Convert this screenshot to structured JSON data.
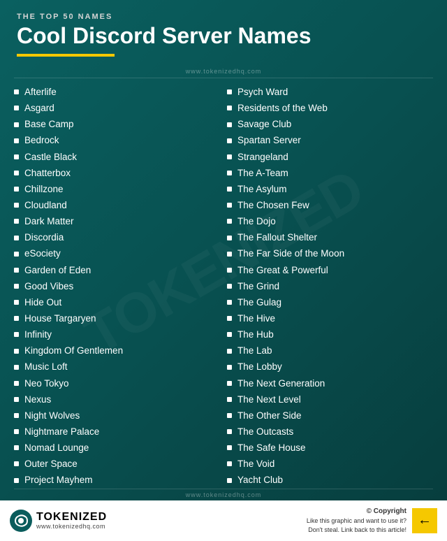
{
  "header": {
    "top_label": "THE TOP 50 NAMES",
    "main_title": "Cool Discord Server Names",
    "website": "www.tokenizedhq.com"
  },
  "column_left": {
    "items": [
      "Afterlife",
      "Asgard",
      "Base Camp",
      "Bedrock",
      "Castle Black",
      "Chatterbox",
      "Chillzone",
      "Cloudland",
      "Dark Matter",
      "Discordia",
      "eSociety",
      "Garden of Eden",
      "Good Vibes",
      "Hide Out",
      "House Targaryen",
      "Infinity",
      "Kingdom Of Gentlemen",
      "Music Loft",
      "Neo Tokyo",
      "Nexus",
      "Night Wolves",
      "Nightmare Palace",
      "Nomad Lounge",
      "Outer Space",
      "Project Mayhem"
    ]
  },
  "column_right": {
    "items": [
      "Psych Ward",
      "Residents of the Web",
      "Savage Club",
      "Spartan Server",
      "Strangeland",
      "The A-Team",
      "The Asylum",
      "The Chosen Few",
      "The Dojo",
      "The Fallout Shelter",
      "The Far Side of the Moon",
      "The Great & Powerful",
      "The Grind",
      "The Gulag",
      "The Hive",
      "The Hub",
      "The Lab",
      "The Lobby",
      "The Next Generation",
      "The Next Level",
      "The Other Side",
      "The Outcasts",
      "The Safe House",
      "The Void",
      "Yacht Club"
    ]
  },
  "footer": {
    "logo_name": "TOKENIZED",
    "logo_sub": "www.tokenizedhq.com",
    "copyright_line1": "© Copyright",
    "copyright_line2": "Like this graphic and want to use it?",
    "copyright_line3": "Don't steal. Link back to this article!"
  }
}
